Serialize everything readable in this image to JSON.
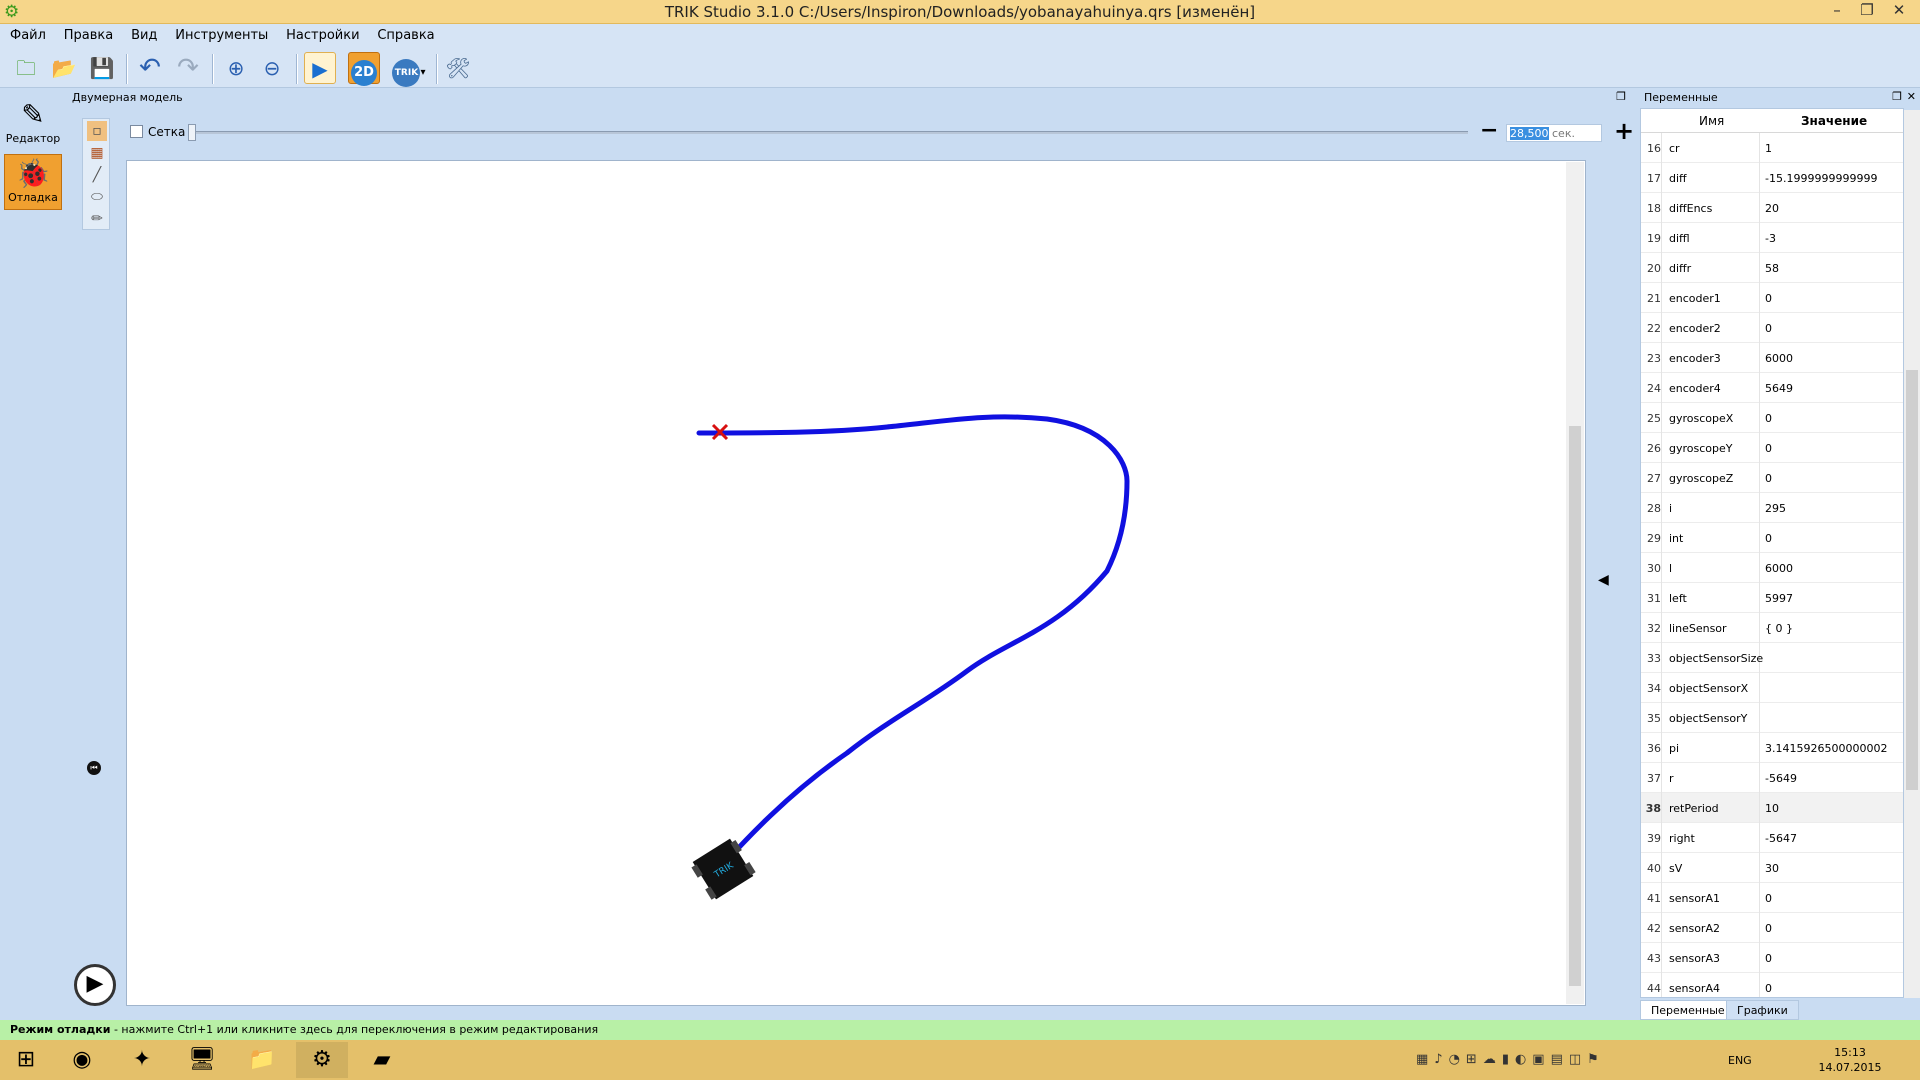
{
  "window": {
    "title": "TRIK Studio 3.1.0 C:/Users/Inspiron/Downloads/yobanayahuinya.qrs [изменён]",
    "minimize": "–",
    "restore": "❐",
    "close": "✕"
  },
  "menu": [
    "Файл",
    "Правка",
    "Вид",
    "Инструменты",
    "Настройки",
    "Справка"
  ],
  "toolbar": {
    "mode_2d_label": "2D",
    "trik_label": "TRIK"
  },
  "modes": {
    "editor_label": "Редактор",
    "debug_label": "Отладка"
  },
  "model_panel": {
    "title": "Двумерная модель",
    "grid_label": "Сетка",
    "time_value": "28,500",
    "time_unit": "сек."
  },
  "variables_panel": {
    "title": "Переменные",
    "col_name": "Имя",
    "col_value": "Значение",
    "rows": [
      {
        "n": "16",
        "name": "cr",
        "value": "1"
      },
      {
        "n": "17",
        "name": "diff",
        "value": "-15.1999999999999"
      },
      {
        "n": "18",
        "name": "diffEncs",
        "value": "20"
      },
      {
        "n": "19",
        "name": "diffl",
        "value": "-3"
      },
      {
        "n": "20",
        "name": "diffr",
        "value": "58"
      },
      {
        "n": "21",
        "name": "encoder1",
        "value": "0"
      },
      {
        "n": "22",
        "name": "encoder2",
        "value": "0"
      },
      {
        "n": "23",
        "name": "encoder3",
        "value": "6000"
      },
      {
        "n": "24",
        "name": "encoder4",
        "value": "5649"
      },
      {
        "n": "25",
        "name": "gyroscopeX",
        "value": "0"
      },
      {
        "n": "26",
        "name": "gyroscopeY",
        "value": "0"
      },
      {
        "n": "27",
        "name": "gyroscopeZ",
        "value": "0"
      },
      {
        "n": "28",
        "name": "i",
        "value": "295"
      },
      {
        "n": "29",
        "name": "int",
        "value": "0"
      },
      {
        "n": "30",
        "name": "l",
        "value": "6000"
      },
      {
        "n": "31",
        "name": "left",
        "value": "5997"
      },
      {
        "n": "32",
        "name": "lineSensor",
        "value": "{ 0 }"
      },
      {
        "n": "33",
        "name": "objectSensorSize",
        "value": ""
      },
      {
        "n": "34",
        "name": "objectSensorX",
        "value": ""
      },
      {
        "n": "35",
        "name": "objectSensorY",
        "value": ""
      },
      {
        "n": "36",
        "name": "pi",
        "value": "3.1415926500000002"
      },
      {
        "n": "37",
        "name": "r",
        "value": "-5649"
      },
      {
        "n": "38",
        "name": "retPeriod",
        "value": "10"
      },
      {
        "n": "39",
        "name": "right",
        "value": "-5647"
      },
      {
        "n": "40",
        "name": "sV",
        "value": "30"
      },
      {
        "n": "41",
        "name": "sensorA1",
        "value": "0"
      },
      {
        "n": "42",
        "name": "sensorA2",
        "value": "0"
      },
      {
        "n": "43",
        "name": "sensorA3",
        "value": "0"
      },
      {
        "n": "44",
        "name": "sensorA4",
        "value": "0"
      }
    ],
    "tab_variables": "Переменные",
    "tab_graphs": "Графики"
  },
  "status": {
    "bold": "Режим отладки",
    "text": " - нажмите Ctrl+1 или кликните здесь для переключения в режим редактирования"
  },
  "robot_label": "TRIK",
  "taskbar": {
    "lang": "ENG",
    "time": "15:13",
    "date": "14.07.2015"
  },
  "colors": {
    "trajectory": "#1010e0",
    "start_mark": "#d81010",
    "accent_orange": "#f0a030"
  }
}
